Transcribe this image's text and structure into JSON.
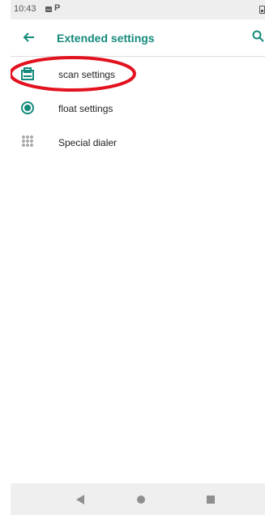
{
  "status_bar": {
    "time": "10:43",
    "icons": [
      "image-notification-icon",
      "parking-notification-icon",
      "battery-icon"
    ],
    "p_glyph": "P"
  },
  "app_bar": {
    "title": "Extended settings",
    "back_icon": "arrow-left-icon",
    "search_icon": "search-icon",
    "accent_color": "#148a7b"
  },
  "settings": {
    "items": [
      {
        "label": "scan settings",
        "icon": "scanner-icon",
        "highlighted": true
      },
      {
        "label": "float settings",
        "icon": "radio-target-icon",
        "highlighted": false
      },
      {
        "label": "Special dialer",
        "icon": "dialpad-icon",
        "highlighted": false
      }
    ]
  },
  "annotation": {
    "color": "#e2121f",
    "shape": "ellipse"
  },
  "nav_bar": {
    "buttons": [
      "back-triangle-icon",
      "home-circle-icon",
      "recents-square-icon"
    ]
  }
}
